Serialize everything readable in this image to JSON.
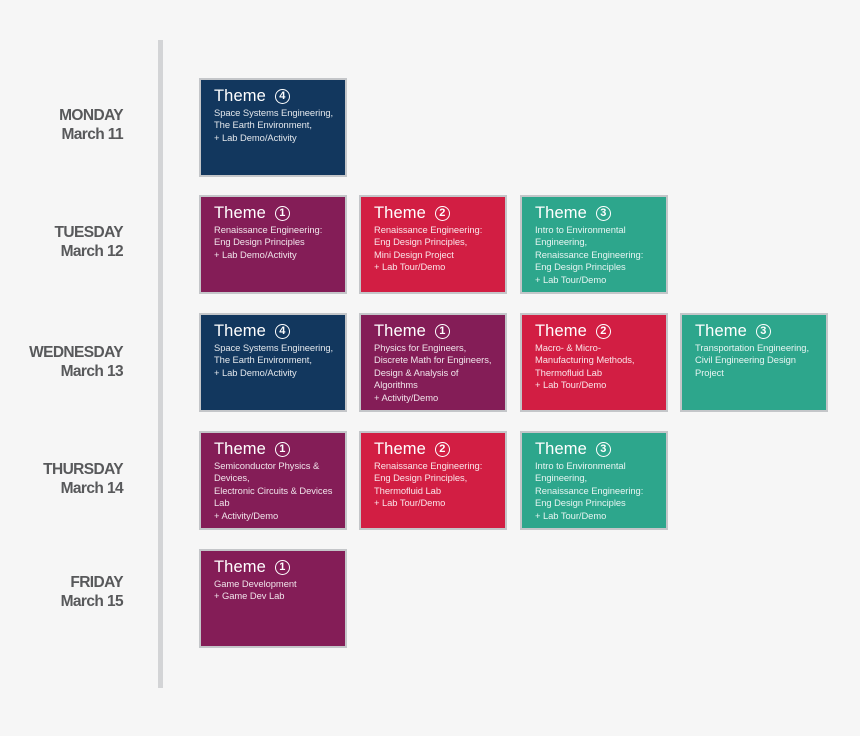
{
  "colors": {
    "theme_1": "#841d57",
    "theme_2": "#d21e43",
    "theme_3": "#2da68c",
    "theme_4": "#12375e",
    "background": "#f6f6f6",
    "timeline": "#d3d4d6",
    "day_text": "#58595b"
  },
  "days": [
    {
      "name": "MONDAY",
      "date": "March 11",
      "sessions": [
        {
          "title": "Theme",
          "theme_number": "4",
          "lines": [
            "Space Systems Engineering,",
            "The Earth Environment,",
            "+ Lab Demo/Activity"
          ]
        }
      ]
    },
    {
      "name": "TUESDAY",
      "date": "March 12",
      "sessions": [
        {
          "title": "Theme",
          "theme_number": "1",
          "lines": [
            "Renaissance Engineering:",
            "Eng Design Principles",
            "+ Lab Demo/Activity"
          ]
        },
        {
          "title": "Theme",
          "theme_number": "2",
          "lines": [
            "Renaissance Engineering:",
            "Eng Design Principles,",
            "Mini Design Project",
            "+ Lab Tour/Demo"
          ]
        },
        {
          "title": "Theme",
          "theme_number": "3",
          "lines": [
            "Intro to Environmental",
            "Engineering,",
            "Renaissance Engineering:",
            "Eng Design Principles",
            "+ Lab Tour/Demo"
          ]
        }
      ]
    },
    {
      "name": "WEDNESDAY",
      "date": "March 13",
      "sessions": [
        {
          "title": "Theme",
          "theme_number": "4",
          "lines": [
            "Space Systems Engineering,",
            "The Earth Environment,",
            "+ Lab Demo/Activity"
          ]
        },
        {
          "title": "Theme",
          "theme_number": "1",
          "lines": [
            "Physics for Engineers,",
            "Discrete Math for Engineers,",
            "Design & Analysis of",
            "Algorithms",
            "+ Activity/Demo"
          ]
        },
        {
          "title": "Theme",
          "theme_number": "2",
          "lines": [
            "Macro- & Micro-",
            "Manufacturing Methods,",
            "Thermofluid Lab",
            "+ Lab Tour/Demo"
          ]
        },
        {
          "title": "Theme",
          "theme_number": "3",
          "lines": [
            "Transportation Engineering,",
            "Civil Engineering Design",
            "Project"
          ]
        }
      ]
    },
    {
      "name": "THURSDAY",
      "date": "March 14",
      "sessions": [
        {
          "title": "Theme",
          "theme_number": "1",
          "lines": [
            "Semiconductor Physics &",
            "Devices,",
            "Electronic Circuits & Devices",
            "Lab",
            "+ Activity/Demo"
          ]
        },
        {
          "title": "Theme",
          "theme_number": "2",
          "lines": [
            "Renaissance Engineering:",
            "Eng Design Principles,",
            "Thermofluid Lab",
            "+ Lab Tour/Demo"
          ]
        },
        {
          "title": "Theme",
          "theme_number": "3",
          "lines": [
            "Intro to Environmental",
            "Engineering,",
            "Renaissance Engineering:",
            "Eng Design Principles",
            "+ Lab Tour/Demo"
          ]
        }
      ]
    },
    {
      "name": "FRIDAY",
      "date": "March 15",
      "sessions": [
        {
          "title": "Theme",
          "theme_number": "1",
          "lines": [
            "Game Development",
            "+ Game Dev Lab"
          ]
        }
      ]
    }
  ]
}
